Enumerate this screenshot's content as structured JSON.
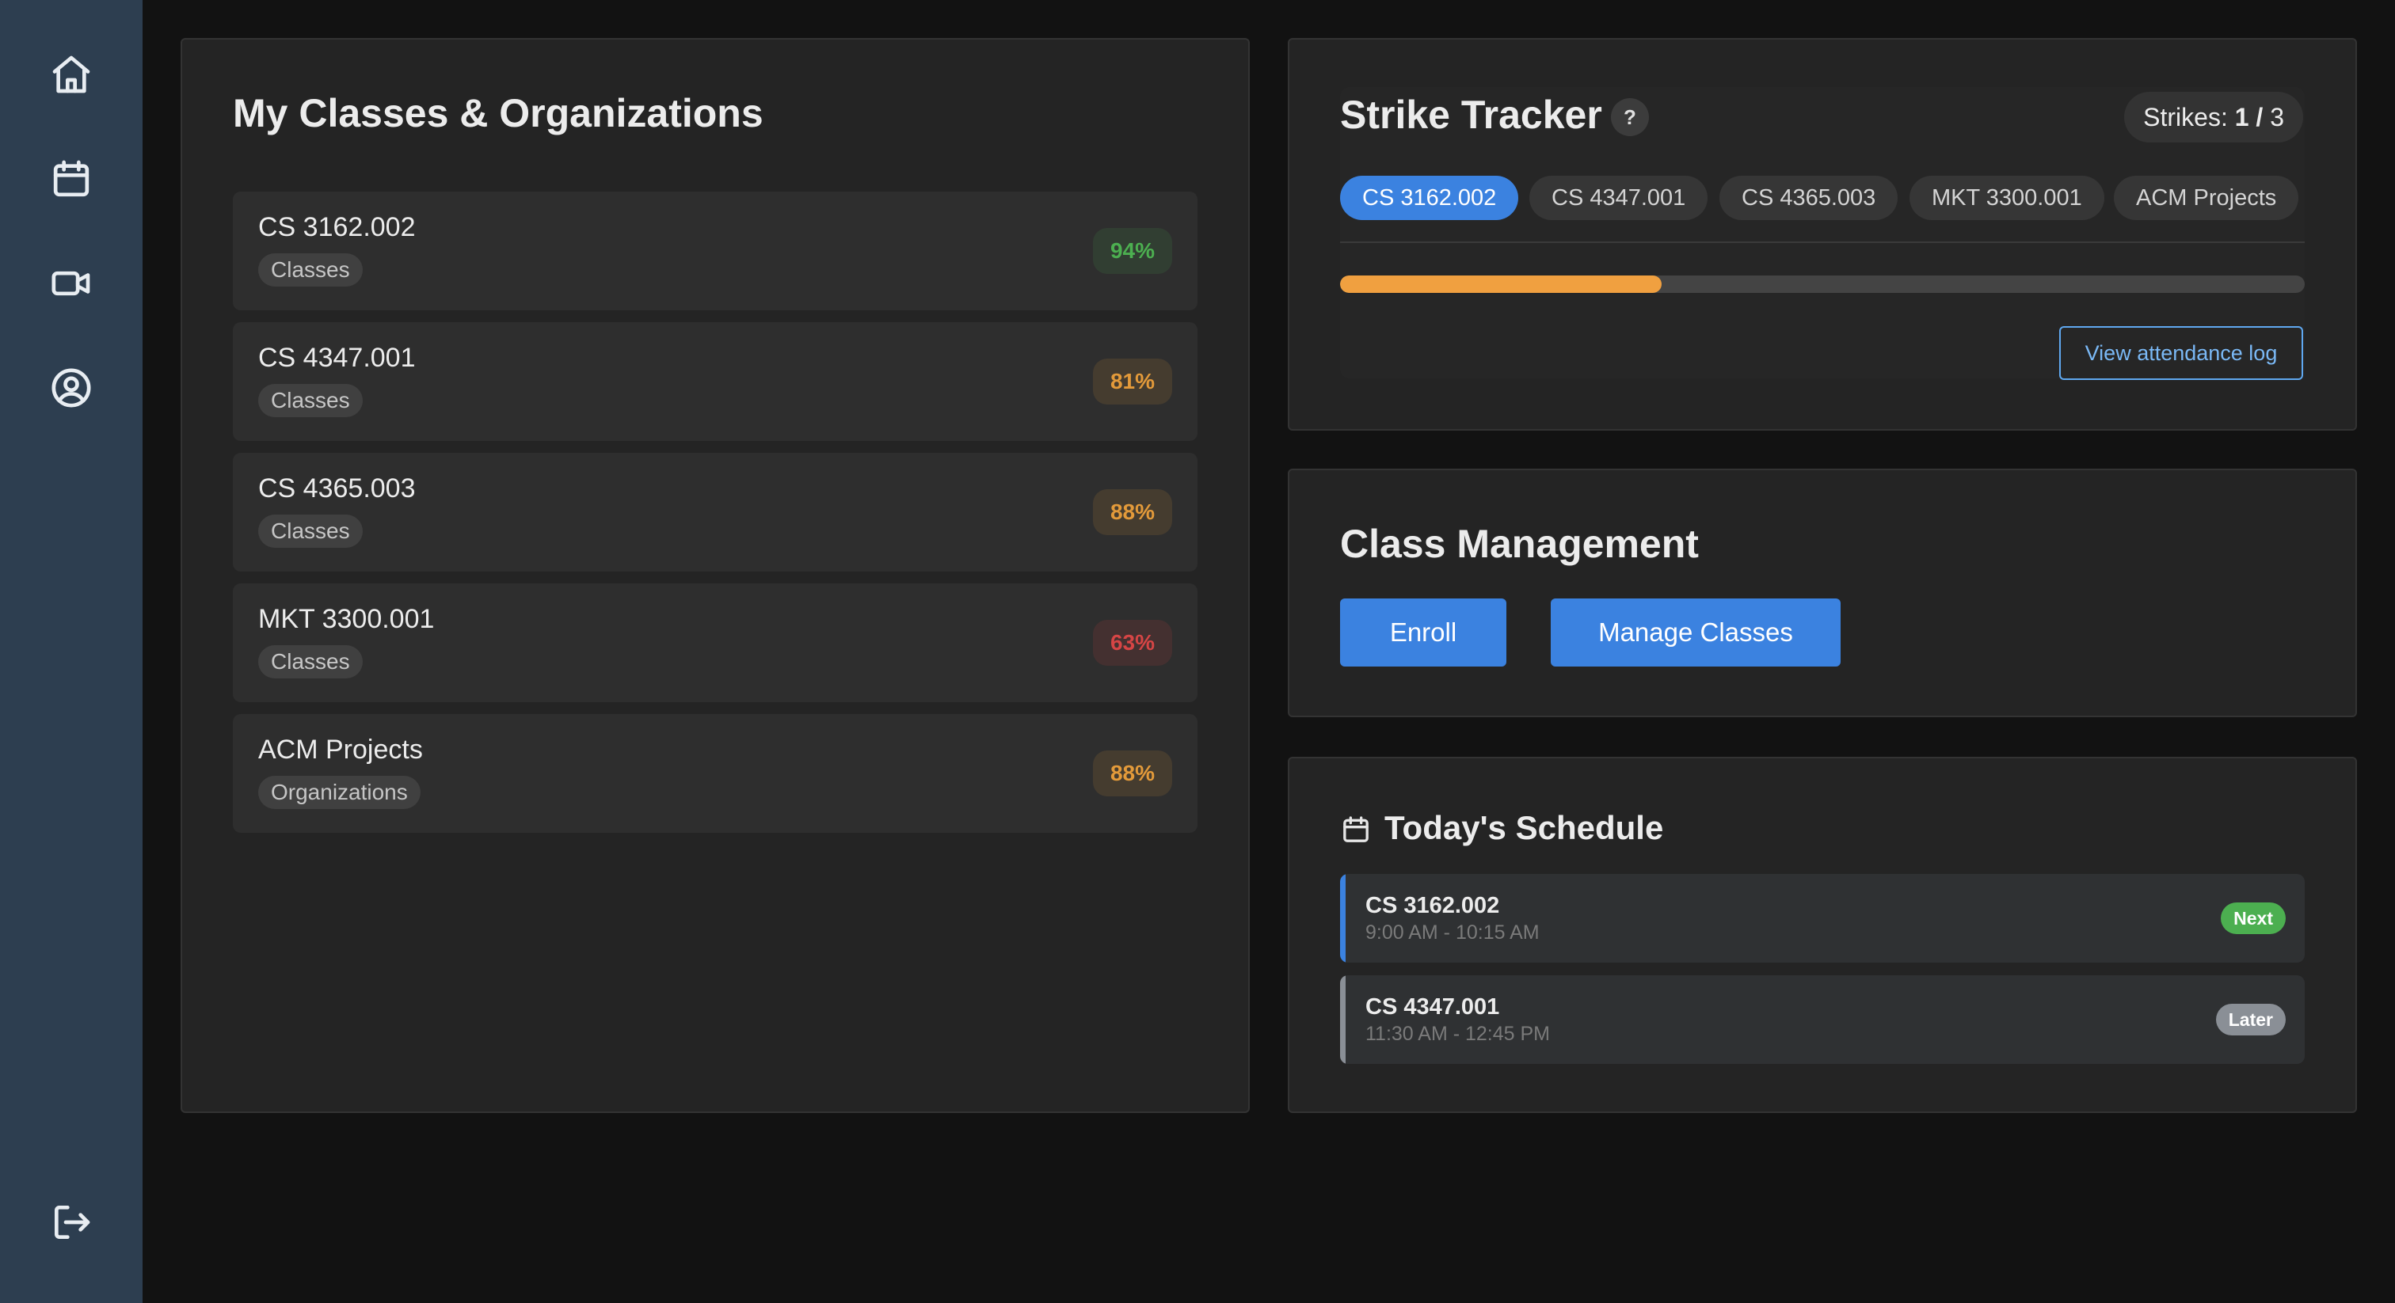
{
  "sidebar": {
    "items": [
      {
        "icon": "home-icon"
      },
      {
        "icon": "calendar-icon"
      },
      {
        "icon": "video-icon"
      },
      {
        "icon": "user-circle-icon"
      }
    ],
    "logout_icon": "logout-icon"
  },
  "classes_panel": {
    "title": "My Classes & Organizations",
    "items": [
      {
        "name": "CS 3162.002",
        "tag": "Classes",
        "percent": "94%",
        "status_color": "#4caf50"
      },
      {
        "name": "CS 4347.001",
        "tag": "Classes",
        "percent": "81%",
        "status_color": "#e39a3a"
      },
      {
        "name": "CS 4365.003",
        "tag": "Classes",
        "percent": "88%",
        "status_color": "#e39a3a"
      },
      {
        "name": "MKT 3300.001",
        "tag": "Classes",
        "percent": "63%",
        "status_color": "#d64545"
      },
      {
        "name": "ACM Projects",
        "tag": "Organizations",
        "percent": "88%",
        "status_color": "#e39a3a"
      }
    ]
  },
  "strike_tracker": {
    "title": "Strike Tracker",
    "help_label": "?",
    "strikes_label": "Strikes:",
    "strikes_count": "1",
    "strikes_separator": "/",
    "strikes_max": "3",
    "tabs": [
      "CS 3162.002",
      "CS 4347.001",
      "CS 4365.003",
      "MKT 3300.001",
      "ACM Projects"
    ],
    "active_tab": 0,
    "progress_fraction": 0.333,
    "progress_color": "#f0a040",
    "log_button": "View attendance log"
  },
  "class_management": {
    "title": "Class Management",
    "enroll_button": "Enroll",
    "manage_button": "Manage Classes"
  },
  "schedule": {
    "title": "Today's Schedule",
    "items": [
      {
        "name": "CS 3162.002",
        "time": "9:00 AM - 10:15 AM",
        "badge": "Next",
        "accent": "#3b82e0",
        "badge_color": "#4caf50"
      },
      {
        "name": "CS 4347.001",
        "time": "11:30 AM - 12:45 PM",
        "badge": "Later",
        "accent": "#8a8f96",
        "badge_color": "#8a8f96"
      }
    ]
  },
  "colors": {
    "accent": "#3b82e0",
    "sidebar": "#2d3e50",
    "background": "#121212"
  }
}
